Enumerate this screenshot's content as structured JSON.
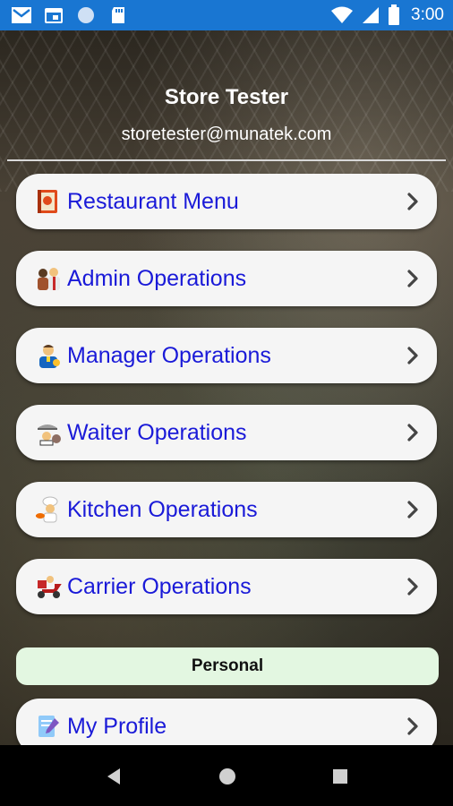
{
  "status_bar": {
    "icons": [
      "gmail-icon",
      "calendar-icon",
      "circle-icon",
      "sd-card-icon",
      "wifi-icon",
      "signal-icon",
      "battery-icon"
    ],
    "time": "3:00"
  },
  "user": {
    "name": "Store Tester",
    "email": "storetester@munatek.com"
  },
  "menu": {
    "items": [
      {
        "label": "Restaurant Menu",
        "icon": "menu-book-icon"
      },
      {
        "label": "Admin Operations",
        "icon": "admin-icon"
      },
      {
        "label": "Manager Operations",
        "icon": "manager-icon"
      },
      {
        "label": "Waiter Operations",
        "icon": "waiter-icon"
      },
      {
        "label": "Kitchen Operations",
        "icon": "chef-icon"
      },
      {
        "label": "Carrier Operations",
        "icon": "delivery-scooter-icon"
      }
    ],
    "section_title": "Personal",
    "personal_items": [
      {
        "label": "My Profile",
        "icon": "profile-icon"
      }
    ]
  },
  "colors": {
    "status_bar": "#1976d2",
    "link_text": "#1a1ad8",
    "button_bg": "#f5f5f5",
    "section_bg": "#e3f7e1"
  }
}
